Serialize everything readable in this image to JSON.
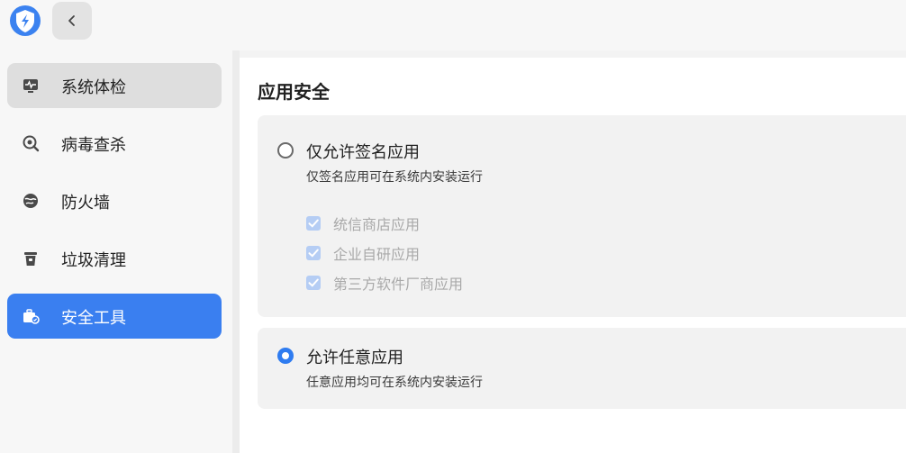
{
  "titlebar": {
    "logo_icon": "shield-bolt-icon",
    "back_icon": "chevron-left-icon"
  },
  "sidebar": {
    "items": [
      {
        "label": "系统体检",
        "icon": "monitor-pulse-icon",
        "state": "selected"
      },
      {
        "label": "病毒查杀",
        "icon": "virus-scan-icon",
        "state": "normal"
      },
      {
        "label": "防火墙",
        "icon": "firewall-globe-icon",
        "state": "normal"
      },
      {
        "label": "垃圾清理",
        "icon": "trash-bin-icon",
        "state": "normal"
      },
      {
        "label": "安全工具",
        "icon": "toolbox-icon",
        "state": "active"
      }
    ]
  },
  "main": {
    "title": "应用安全",
    "options": [
      {
        "title": "仅允许签名应用",
        "desc": "仅签名应用可在系统内安装运行",
        "selected": false,
        "checks": [
          {
            "label": "统信商店应用",
            "checked": true,
            "disabled": true
          },
          {
            "label": "企业自研应用",
            "checked": true,
            "disabled": true
          },
          {
            "label": "第三方软件厂商应用",
            "checked": true,
            "disabled": true
          }
        ]
      },
      {
        "title": "允许任意应用",
        "desc": "任意应用均可在系统内安装运行",
        "selected": true
      }
    ]
  },
  "colors": {
    "accent": "#3a7ff0",
    "check_disabled": "#b5cdf4"
  }
}
